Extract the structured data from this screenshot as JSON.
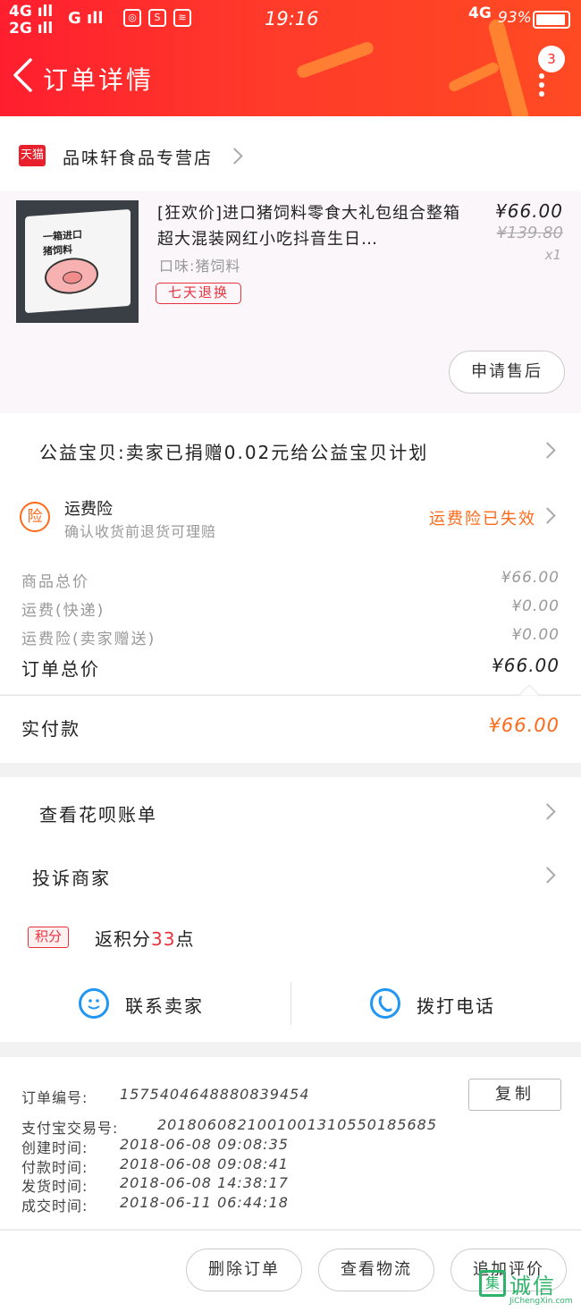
{
  "status_bar": {
    "signal_left": "4G\n2G",
    "signal_right": "G",
    "time": "19:16",
    "network": "4G",
    "battery": "93%"
  },
  "header": {
    "title": "订单详情",
    "badge_count": "3"
  },
  "shop": {
    "tag": "天猫",
    "name": "品味轩食品专营店"
  },
  "product": {
    "title": "[狂欢价]进口猪饲料零食大礼包组合整箱超大混装网红小吃抖音生日…",
    "spec": "口味:猪饲料",
    "tag": "七天退换",
    "price": "¥66.00",
    "original_price": "¥139.80",
    "quantity": "x1",
    "aftersale_button": "申请售后"
  },
  "charity": {
    "text": "公益宝贝:卖家已捐赠0.02元给公益宝贝计划"
  },
  "insurance": {
    "icon": "险",
    "title": "运费险",
    "subtitle": "确认收货前退货可理赔",
    "status": "运费险已失效"
  },
  "fees": [
    {
      "label": "商品总价",
      "value": "¥66.00"
    },
    {
      "label": "运费(快递)",
      "value": "¥0.00"
    },
    {
      "label": "运费险(卖家赠送)",
      "value": "¥0.00"
    }
  ],
  "order_total": {
    "label": "订单总价",
    "value": "¥66.00"
  },
  "paid": {
    "label": "实付款",
    "value": "¥66.00"
  },
  "links": {
    "huabei": "查看花呗账单",
    "complain": "投诉商家"
  },
  "points": {
    "badge": "积分",
    "prefix": "返积分",
    "count": "33",
    "suffix": "点"
  },
  "contact": {
    "seller": "联系卖家",
    "call": "拨打电话"
  },
  "order_info": {
    "order_no_label": "订单编号:",
    "order_no": "1575404648880839454",
    "copy": "复制",
    "alipay_label": "支付宝交易号:",
    "alipay_no": "2018060821001001310550185685",
    "created_label": "创建时间:",
    "created": "2018-06-08 09:08:35",
    "paid_label": "付款时间:",
    "paid": "2018-06-08 09:08:41",
    "shipped_label": "发货时间:",
    "shipped": "2018-06-08 14:38:17",
    "done_label": "成交时间:",
    "done": "2018-06-11 06:44:18"
  },
  "actions": {
    "delete": "删除订单",
    "logistics": "查看物流",
    "review": "追加评价"
  },
  "watermark": {
    "text": "诚信",
    "box": "集",
    "url": "JiChengXin.com"
  }
}
